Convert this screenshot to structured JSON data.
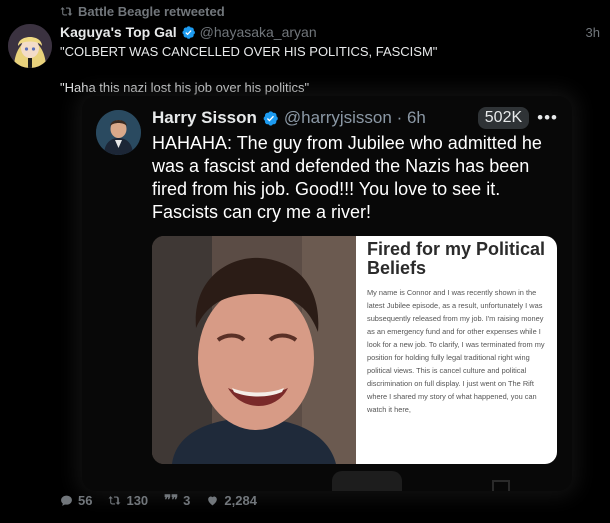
{
  "retweet": {
    "text": "Battle Beagle retweeted"
  },
  "tweet": {
    "author_name": "Kaguya's Top Gal",
    "author_handle": "@hayasaka_aryan",
    "time": "3h",
    "text_line1": "\"COLBERT WAS CANCELLED OVER HIS POLITICS, FASCISM\"",
    "text_line2": "\"Haha this nazi lost his job over his politics\""
  },
  "quote": {
    "author_name": "Harry Sisson",
    "author_handle": "@harryjsisson · 6h",
    "views": "502K",
    "more": "•••",
    "text": "HAHAHA: The guy from Jubilee who admitted he was a fascist and defended the Nazis has been fired from his job. Good!!! You love to see it. Fascists can cry me a river!",
    "media": {
      "doc_title": "Fired for my Political Beliefs",
      "doc_body": "My name is Connor and I was recently shown in the latest Jubilee episode, as a result, unfortunately I was subsequently released from my job. I'm raising money as an emergency fund and for other expenses while I look for a new job. To clarify, I was terminated from my position for holding fully legal traditional right wing political views. This is cancel culture and political discrimination on full display. I just went on The Rift where I shared my story of what happened, you can watch it here,"
    }
  },
  "actions": {
    "replies": "56",
    "retweets": "130",
    "quotes": "3",
    "likes": "2,284"
  },
  "colors": {
    "background": "#000000",
    "verified": "#1d9bf0",
    "muted": "#71767b"
  }
}
